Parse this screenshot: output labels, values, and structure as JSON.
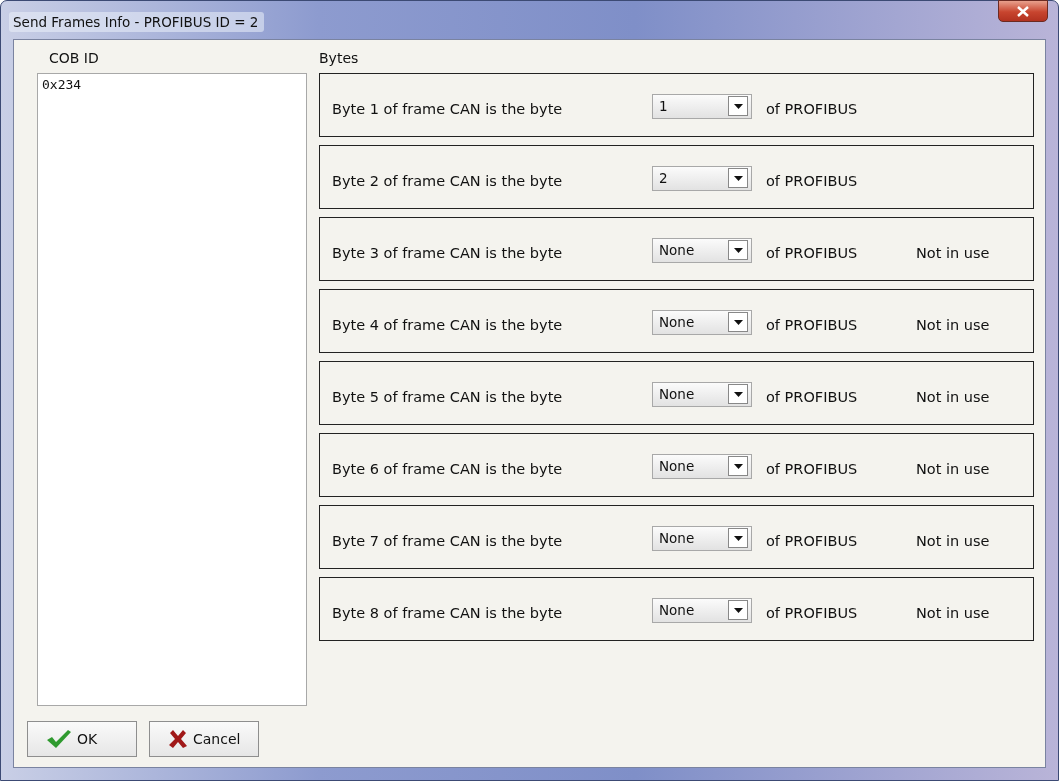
{
  "window": {
    "title": "Send Frames Info - PROFIBUS ID = 2"
  },
  "cob_id": {
    "heading": "COB ID",
    "items": [
      {
        "label": "0x234",
        "selected": false
      }
    ]
  },
  "bytes": {
    "heading": "Bytes",
    "rows": [
      {
        "label": "Byte 1 of frame CAN is the byte",
        "value": "1",
        "suffix": "of PROFIBUS"
      },
      {
        "label": "Byte 2 of frame CAN is the byte",
        "value": "2",
        "suffix": "of PROFIBUS"
      },
      {
        "label": "Byte 3 of frame CAN is the byte",
        "value": "None",
        "suffix": "of PROFIBUS",
        "status": "Not in use"
      },
      {
        "label": "Byte 4 of frame CAN is the byte",
        "value": "None",
        "suffix": "of PROFIBUS",
        "status": "Not in use"
      },
      {
        "label": "Byte 5 of frame CAN is the byte",
        "value": "None",
        "suffix": "of PROFIBUS",
        "status": "Not in use"
      },
      {
        "label": "Byte 6 of frame CAN is the byte",
        "value": "None",
        "suffix": "of PROFIBUS",
        "status": "Not in use"
      },
      {
        "label": "Byte 7 of frame CAN is the byte",
        "value": "None",
        "suffix": "of PROFIBUS",
        "status": "Not in use"
      },
      {
        "label": "Byte 8 of frame CAN is the byte",
        "value": "None",
        "suffix": "of PROFIBUS",
        "status": "Not in use"
      }
    ]
  },
  "buttons": [
    {
      "kind": "ok",
      "label": "OK"
    },
    {
      "kind": "cancel",
      "label": "Cancel"
    }
  ]
}
